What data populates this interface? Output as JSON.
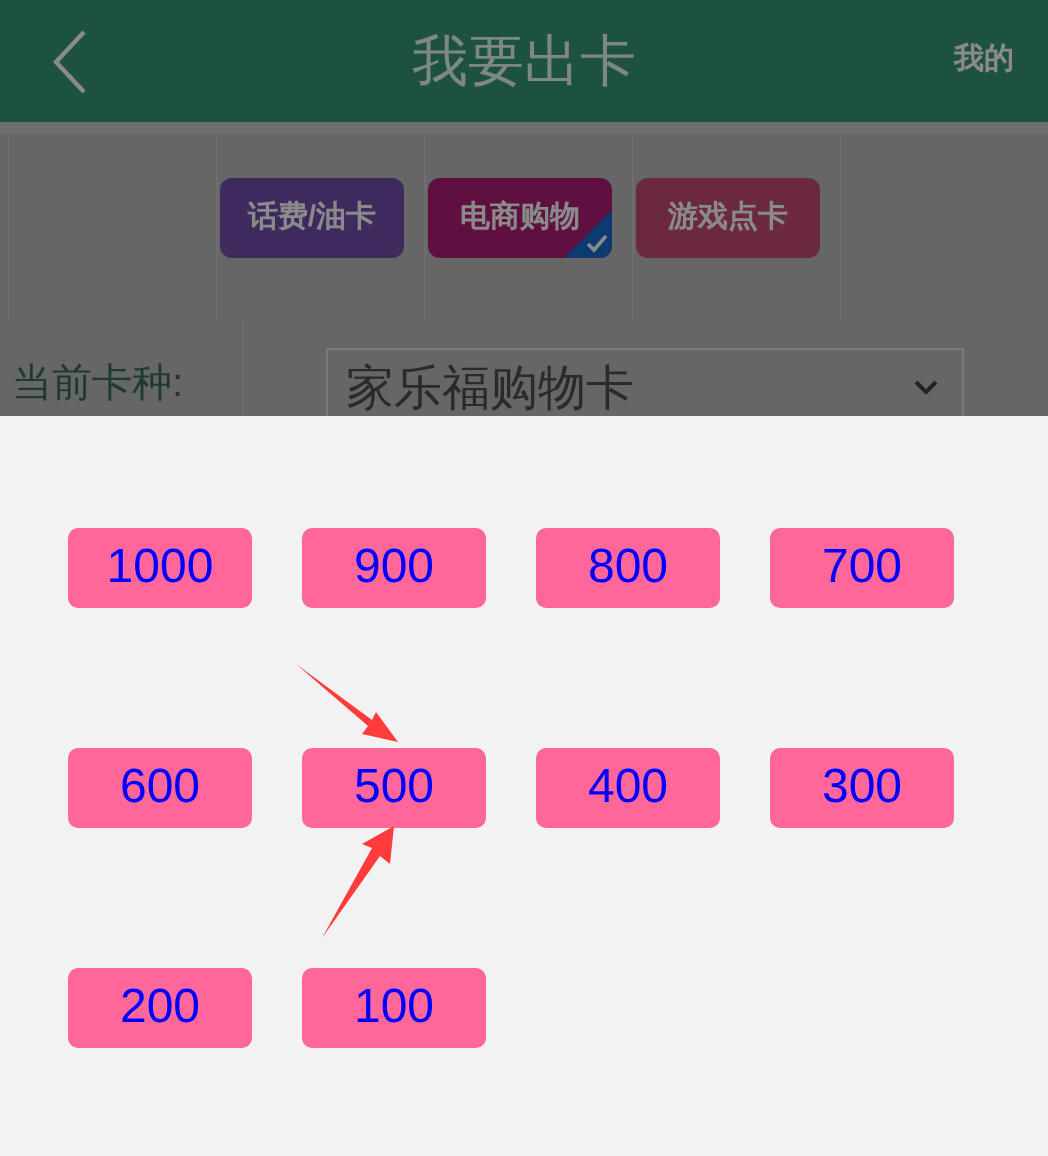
{
  "header": {
    "title": "我要出卡",
    "right_link": "我的"
  },
  "card_categories": [
    {
      "label": "话费/油卡",
      "color": "#3f2a5d",
      "selected": false
    },
    {
      "label": "电商购物",
      "color": "#5f1040",
      "selected": true
    },
    {
      "label": "游戏点卡",
      "color": "#6a2940",
      "selected": false
    }
  ],
  "card_type": {
    "label": "当前卡种:",
    "value": "家乐福购物卡"
  },
  "amounts": [
    "1000",
    "900",
    "800",
    "700",
    "600",
    "500",
    "400",
    "300",
    "200",
    "100"
  ]
}
